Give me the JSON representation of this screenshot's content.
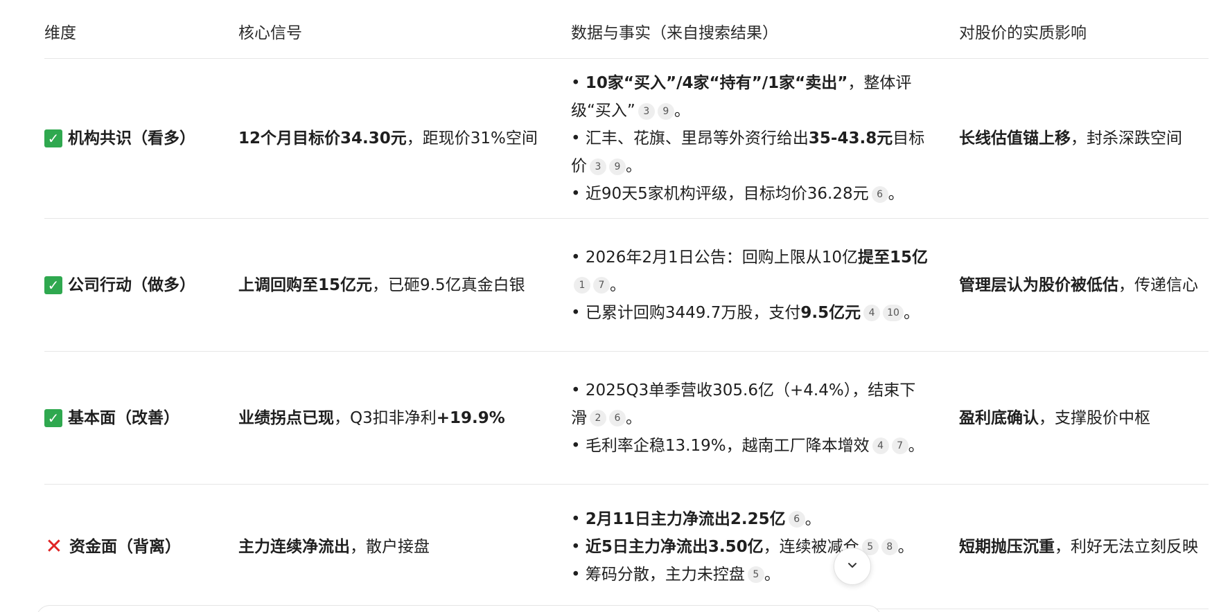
{
  "headers": [
    "维度",
    "核心信号",
    "数据与事实（来自搜索结果）",
    "对股价的实质影响"
  ],
  "rows": [
    {
      "icon": "check-icon",
      "dimension": "机构共识（看多）",
      "signal_bold": "12个月目标价34.30元",
      "signal_rest": "，距现价31%空间",
      "facts": [
        {
          "segments": [
            {
              "b": "10家“买入”/4家“持有”/1家“卖出”"
            },
            {
              "t": "，整体评级“买入”"
            }
          ],
          "cites": [
            "3",
            "9"
          ]
        },
        {
          "segments": [
            {
              "t": "汇丰、花旗、里昂等外资行给出"
            },
            {
              "b": "35-43.8元"
            },
            {
              "t": "目标价"
            }
          ],
          "cites": [
            "3",
            "9"
          ]
        },
        {
          "segments": [
            {
              "t": "近90天5家机构评级，目标均价36.28元"
            }
          ],
          "cites": [
            "6"
          ]
        }
      ],
      "impact_bold": "长线估值锚上移",
      "impact_rest": "，封杀深跌空间"
    },
    {
      "icon": "check-icon",
      "dimension": "公司行动（做多）",
      "signal_bold": "上调回购至15亿元",
      "signal_rest": "，已砸9.5亿真金白银",
      "facts": [
        {
          "segments": [
            {
              "t": "2026年2月1日公告：回购上限从10亿"
            },
            {
              "b": "提至15亿"
            }
          ],
          "cites": [
            "1",
            "7"
          ]
        },
        {
          "segments": [
            {
              "t": "已累计回购3449.7万股，支付"
            },
            {
              "b": "9.5亿元"
            }
          ],
          "cites": [
            "4",
            "10"
          ]
        }
      ],
      "impact_bold": "管理层认为股价被低估",
      "impact_rest": "，传递信心"
    },
    {
      "icon": "check-icon",
      "dimension": "基本面（改善）",
      "signal_bold": "业绩拐点已现",
      "signal_rest": "，Q3扣非净利",
      "signal_bold2": "+19.9%",
      "facts": [
        {
          "segments": [
            {
              "t": "2025Q3单季营收305.6亿（+4.4%），结束下滑"
            }
          ],
          "cites": [
            "2",
            "6"
          ]
        },
        {
          "segments": [
            {
              "t": "毛利率企稳13.19%，越南工厂降本增效"
            }
          ],
          "cites": [
            "4",
            "7"
          ]
        }
      ],
      "impact_bold": "盈利底确认",
      "impact_rest": "，支撑股价中枢"
    },
    {
      "icon": "cross-icon",
      "dimension": "资金面（背离）",
      "signal_bold": "主力连续净流出",
      "signal_rest": "，散户接盘",
      "facts": [
        {
          "segments": [
            {
              "b": "2月11日主力净流出2.25亿"
            }
          ],
          "cites": [
            "6"
          ]
        },
        {
          "segments": [
            {
              "b": "近5日主力净流出3.50亿"
            },
            {
              "t": "，连续被减仓"
            }
          ],
          "cites": [
            "5",
            "8"
          ]
        },
        {
          "segments": [
            {
              "t": "筹码分散，主力未控盘"
            }
          ],
          "cites": [
            "5"
          ]
        }
      ],
      "impact_bold": "短期抛压沉重",
      "impact_rest": "，利好无法立刻反映"
    }
  ],
  "bullet_char": "•",
  "period_char": "。"
}
